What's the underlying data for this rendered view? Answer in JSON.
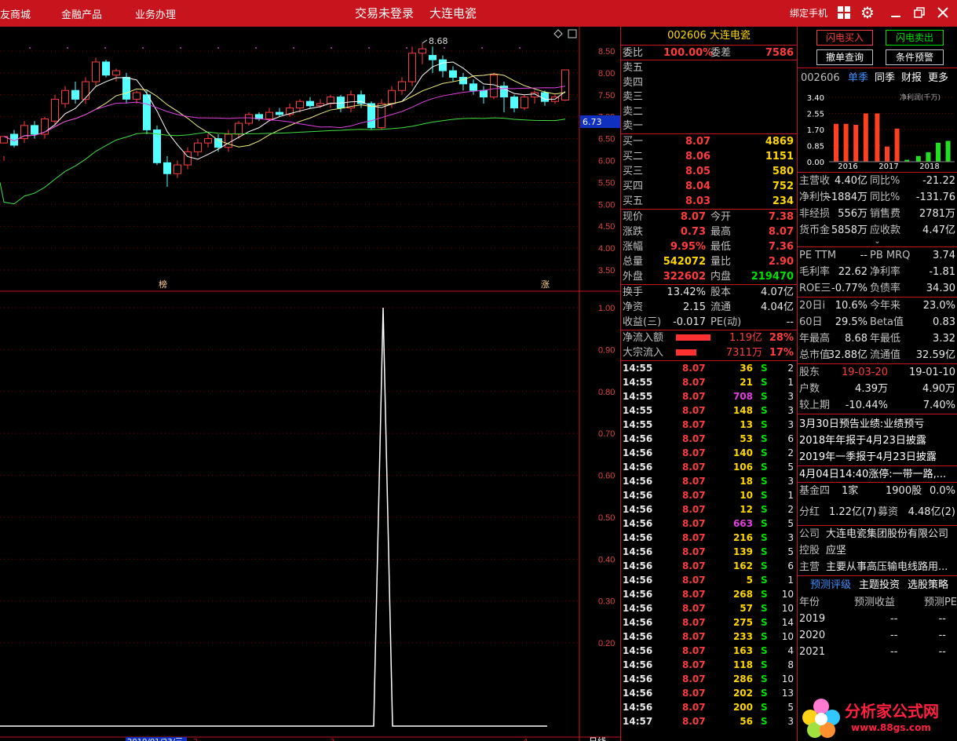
{
  "topbar": {
    "nav": [
      "友商城",
      "金融产品",
      "业务办理"
    ],
    "title1": "交易未登录",
    "title2": "大连电瓷",
    "bind_phone": "绑定手机"
  },
  "chart": {
    "price_ticks": [
      "8.50",
      "8.00",
      "7.50",
      "7.00",
      "6.50",
      "6.00",
      "5.50",
      "5.00",
      "4.50",
      "4.00",
      "3.50"
    ],
    "current_price_tag": "6.73",
    "high_label": "8.68",
    "marker_left": "榜",
    "marker_right": "涨",
    "ind_ticks": [
      "1.00",
      "0.90",
      "0.80",
      "0.70",
      "0.60",
      "0.50",
      "0.40",
      "0.30",
      "0.20"
    ],
    "date_label": "2019/01/23/三",
    "bottom_labels": [
      "2",
      "3",
      "4"
    ],
    "period_label": "日线",
    "colors": {
      "up": "#ff3c3c",
      "down": "#54ffff",
      "ma5": "#ffffff",
      "ma10": "#f0f080",
      "ma20": "#e040e0",
      "ma60": "#40e040",
      "grid": "#7a0000"
    }
  },
  "chart_data": {
    "type": "candlestick",
    "ylim": [
      3.3,
      8.7
    ],
    "candles": [
      [
        6.4,
        6.55,
        6.1,
        6.0
      ],
      [
        6.6,
        6.35,
        6.7,
        6.3
      ],
      [
        6.5,
        6.8,
        6.9,
        6.4
      ],
      [
        6.8,
        6.6,
        6.9,
        6.5
      ],
      [
        6.6,
        6.95,
        7.0,
        6.5
      ],
      [
        6.9,
        7.4,
        7.5,
        6.8
      ],
      [
        7.3,
        7.6,
        7.7,
        7.2
      ],
      [
        7.6,
        7.4,
        7.8,
        7.3
      ],
      [
        7.4,
        7.8,
        7.9,
        7.3
      ],
      [
        7.8,
        8.25,
        8.35,
        7.7
      ],
      [
        8.25,
        7.95,
        8.3,
        7.9
      ],
      [
        7.95,
        8.05,
        8.1,
        7.8
      ],
      [
        7.9,
        7.4,
        8.0,
        7.3
      ],
      [
        7.4,
        7.55,
        7.6,
        7.3
      ],
      [
        7.5,
        6.7,
        7.6,
        6.6
      ],
      [
        6.7,
        5.95,
        6.8,
        5.9
      ],
      [
        5.95,
        5.7,
        6.1,
        5.4
      ],
      [
        5.7,
        5.9,
        6.0,
        5.6
      ],
      [
        5.9,
        6.2,
        6.3,
        5.8
      ],
      [
        6.2,
        6.4,
        6.5,
        6.1
      ],
      [
        6.4,
        6.5,
        6.6,
        6.3
      ],
      [
        6.5,
        6.3,
        6.6,
        6.2
      ],
      [
        6.3,
        6.6,
        6.7,
        6.2
      ],
      [
        6.6,
        6.85,
        6.9,
        6.5
      ],
      [
        6.85,
        7.05,
        7.1,
        6.8
      ],
      [
        7.05,
        6.95,
        7.1,
        6.9
      ],
      [
        6.95,
        7.1,
        7.2,
        6.9
      ],
      [
        7.1,
        7.05,
        7.2,
        7.0
      ],
      [
        7.05,
        7.2,
        7.3,
        7.0
      ],
      [
        7.2,
        7.35,
        7.4,
        7.1
      ],
      [
        7.35,
        7.25,
        7.45,
        7.2
      ],
      [
        7.25,
        7.3,
        7.4,
        7.2
      ],
      [
        7.3,
        7.45,
        7.5,
        7.2
      ],
      [
        7.45,
        7.2,
        7.5,
        7.1
      ],
      [
        7.2,
        7.5,
        7.6,
        7.1
      ],
      [
        7.5,
        7.3,
        7.6,
        7.2
      ],
      [
        7.3,
        6.75,
        7.35,
        6.7
      ],
      [
        6.75,
        7.3,
        7.4,
        6.7
      ],
      [
        7.3,
        7.6,
        7.7,
        7.2
      ],
      [
        7.6,
        7.8,
        7.9,
        7.5
      ],
      [
        7.8,
        8.45,
        8.6,
        7.7
      ],
      [
        8.45,
        8.55,
        8.68,
        8.2
      ],
      [
        8.4,
        8.3,
        8.6,
        8.0
      ],
      [
        8.3,
        8.05,
        8.4,
        7.9
      ],
      [
        8.05,
        7.9,
        8.15,
        7.8
      ],
      [
        7.9,
        7.75,
        8.0,
        7.6
      ],
      [
        7.75,
        7.6,
        7.85,
        7.5
      ],
      [
        7.6,
        7.45,
        7.7,
        7.3
      ],
      [
        7.45,
        7.95,
        8.0,
        7.4
      ],
      [
        7.7,
        7.45,
        7.8,
        7.1
      ],
      [
        7.45,
        7.2,
        7.5,
        7.1
      ],
      [
        7.2,
        7.45,
        7.5,
        7.15
      ],
      [
        7.45,
        7.55,
        7.6,
        7.3
      ],
      [
        7.55,
        7.35,
        7.6,
        7.25
      ],
      [
        7.35,
        7.45,
        7.5,
        7.3
      ],
      [
        7.38,
        8.07,
        8.07,
        7.36
      ]
    ]
  },
  "quote": {
    "code": "002606",
    "name": "大连电瓷",
    "weibi_label": "委比",
    "weibi": "100.00%",
    "weicha_label": "委差",
    "weicha": "7586",
    "sells": [
      "卖五",
      "卖四",
      "卖三",
      "卖二",
      "卖一"
    ],
    "buys": [
      {
        "label": "买一",
        "price": "8.07",
        "vol": "4869"
      },
      {
        "label": "买二",
        "price": "8.06",
        "vol": "1151"
      },
      {
        "label": "买三",
        "price": "8.05",
        "vol": "580"
      },
      {
        "label": "买四",
        "price": "8.04",
        "vol": "752"
      },
      {
        "label": "买五",
        "price": "8.03",
        "vol": "234"
      }
    ],
    "stats": [
      {
        "l1": "现价",
        "v1": "8.07",
        "c1": "red",
        "l2": "今开",
        "v2": "7.38",
        "c2": "red"
      },
      {
        "l1": "涨跌",
        "v1": "0.73",
        "c1": "red",
        "l2": "最高",
        "v2": "8.07",
        "c2": "red"
      },
      {
        "l1": "涨幅",
        "v1": "9.95%",
        "c1": "red",
        "l2": "最低",
        "v2": "7.36",
        "c2": "red"
      },
      {
        "l1": "总量",
        "v1": "542072",
        "c1": "yel",
        "l2": "量比",
        "v2": "2.90",
        "c2": "red"
      },
      {
        "l1": "外盘",
        "v1": "322602",
        "c1": "red",
        "l2": "内盘",
        "v2": "219470",
        "c2": "grn"
      }
    ],
    "stats2": [
      {
        "l1": "换手",
        "v1": "13.42%",
        "l2": "股本",
        "v2": "4.07亿"
      },
      {
        "l1": "净资",
        "v1": "2.15",
        "l2": "流通",
        "v2": "4.04亿"
      },
      {
        "l1": "收益(三)",
        "v1": "-0.017",
        "l2": "PE(动)",
        "v2": "--"
      }
    ],
    "flow": [
      {
        "label": "净流入额",
        "value": "1.19亿",
        "pct": "28%",
        "fill": 1.0
      },
      {
        "label": "大宗流入",
        "value": "7311万",
        "pct": "17%",
        "fill": 0.6
      }
    ],
    "ticks": [
      [
        "14:55",
        "8.07",
        "36",
        "S",
        "2"
      ],
      [
        "14:55",
        "8.07",
        "21",
        "S",
        "1"
      ],
      [
        "14:55",
        "8.07",
        "708",
        "S",
        "3"
      ],
      [
        "14:55",
        "8.07",
        "148",
        "S",
        "3"
      ],
      [
        "14:55",
        "8.07",
        "13",
        "S",
        "3"
      ],
      [
        "14:56",
        "8.07",
        "53",
        "S",
        "6"
      ],
      [
        "14:56",
        "8.07",
        "140",
        "S",
        "2"
      ],
      [
        "14:56",
        "8.07",
        "106",
        "S",
        "5"
      ],
      [
        "14:56",
        "8.07",
        "18",
        "S",
        "3"
      ],
      [
        "14:56",
        "8.07",
        "10",
        "S",
        "1"
      ],
      [
        "14:56",
        "8.07",
        "12",
        "S",
        "2"
      ],
      [
        "14:56",
        "8.07",
        "663",
        "S",
        "5"
      ],
      [
        "14:56",
        "8.07",
        "216",
        "S",
        "3"
      ],
      [
        "14:56",
        "8.07",
        "139",
        "S",
        "5"
      ],
      [
        "14:56",
        "8.07",
        "162",
        "S",
        "6"
      ],
      [
        "14:56",
        "8.07",
        "5",
        "S",
        "1"
      ],
      [
        "14:56",
        "8.07",
        "268",
        "S",
        "10"
      ],
      [
        "14:56",
        "8.07",
        "57",
        "S",
        "10"
      ],
      [
        "14:56",
        "8.07",
        "275",
        "S",
        "14"
      ],
      [
        "14:56",
        "8.07",
        "233",
        "S",
        "10"
      ],
      [
        "14:56",
        "8.07",
        "163",
        "S",
        "4"
      ],
      [
        "14:56",
        "8.07",
        "118",
        "S",
        "8"
      ],
      [
        "14:56",
        "8.07",
        "286",
        "S",
        "10"
      ],
      [
        "14:56",
        "8.07",
        "202",
        "S",
        "13"
      ],
      [
        "14:56",
        "8.07",
        "200",
        "S",
        "5"
      ],
      [
        "14:57",
        "8.07",
        "56",
        "S",
        "3"
      ]
    ]
  },
  "f10": {
    "btn_buy": "闪电买入",
    "btn_sell": "闪电卖出",
    "btn_cancel": "撤单查询",
    "btn_cond": "条件预警",
    "code": "002606",
    "tabs": [
      "单季",
      "同季",
      "财报",
      "更多"
    ],
    "mini_unit": "净利润(千万)",
    "mini_yticks": [
      "3.40",
      "2.55",
      "1.70",
      "0.85",
      "0.00"
    ],
    "mini_years": [
      "2016",
      "2017",
      "2018"
    ],
    "mini_bars": [
      {
        "v": 2.0,
        "c": "#ff4020"
      },
      {
        "v": 2.0,
        "c": "#ff4020"
      },
      {
        "v": 1.95,
        "c": "#ff4020"
      },
      {
        "v": 2.55,
        "c": "#ff4020"
      },
      {
        "v": 2.55,
        "c": "#ff4020"
      },
      {
        "v": 0.8,
        "c": "#ff4020"
      },
      {
        "v": 1.75,
        "c": "#ff4020"
      },
      {
        "v": 0.1,
        "c": "#20e020"
      },
      {
        "v": 0.3,
        "c": "#20e020"
      },
      {
        "v": 0.5,
        "c": "#20e020"
      },
      {
        "v": 1.0,
        "c": "#20e020"
      },
      {
        "v": 1.1,
        "c": "#20e020"
      }
    ],
    "fin": [
      [
        "主营收",
        "4.40亿",
        "同比%",
        "-21.22"
      ],
      [
        "净利快",
        "-1884万",
        "同比%",
        "-131.76"
      ],
      [
        "非经损",
        "556万",
        "销售费",
        "2781万"
      ],
      [
        "货币金",
        "5858万",
        "应收款",
        "4.47亿"
      ]
    ],
    "val": [
      [
        "PE TTM",
        "--",
        "PB MRQ",
        "3.74"
      ],
      [
        "毛利率",
        "22.62",
        "净利率",
        "-1.81"
      ],
      [
        "ROE三",
        "-0.77%",
        "负债率",
        "34.30"
      ]
    ],
    "perf": [
      [
        "20日i",
        "10.6%",
        "今年来",
        "23.0%"
      ],
      [
        "60日",
        "29.5%",
        "Beta值",
        "0.83"
      ],
      [
        "年最高",
        "8.68",
        "年最低",
        "3.32"
      ],
      [
        "总市值",
        "32.88亿",
        "流通值",
        "32.59亿"
      ]
    ],
    "holders": [
      [
        "股东",
        "19-03-20",
        "19-01-10"
      ],
      [
        "户数",
        "4.39万",
        "4.90万"
      ],
      [
        "较上期",
        "-10.44%",
        "7.40%"
      ]
    ],
    "notes": [
      "3月30日预告业绩:业绩预亏",
      "2018年年报于4月23日披露",
      "2019年一季报于4月23日披露",
      "4月04日14:40涨停:一带一路,..."
    ],
    "fund": [
      "基金四",
      "1家",
      "1900股",
      "0.0%"
    ],
    "div": [
      "分红",
      "1.22亿(7)",
      "募资",
      "4.48亿(2)"
    ],
    "company": [
      [
        "公司",
        "大连电瓷集团股份有限公司"
      ],
      [
        "控股",
        "应坚"
      ],
      [
        "主营",
        "主要从事高压输电线路用..."
      ]
    ],
    "tabs2": [
      "预测评级",
      "主题投资",
      "选股策略"
    ],
    "forecast_head": [
      "年份",
      "预测收益",
      "预测PE"
    ],
    "forecast": [
      [
        "2019",
        "--",
        "--"
      ],
      [
        "2020",
        "--",
        "--"
      ],
      [
        "2021",
        "--",
        "--"
      ]
    ],
    "logo_text": "分析家公式网",
    "logo_url": "www.88gs.com"
  }
}
